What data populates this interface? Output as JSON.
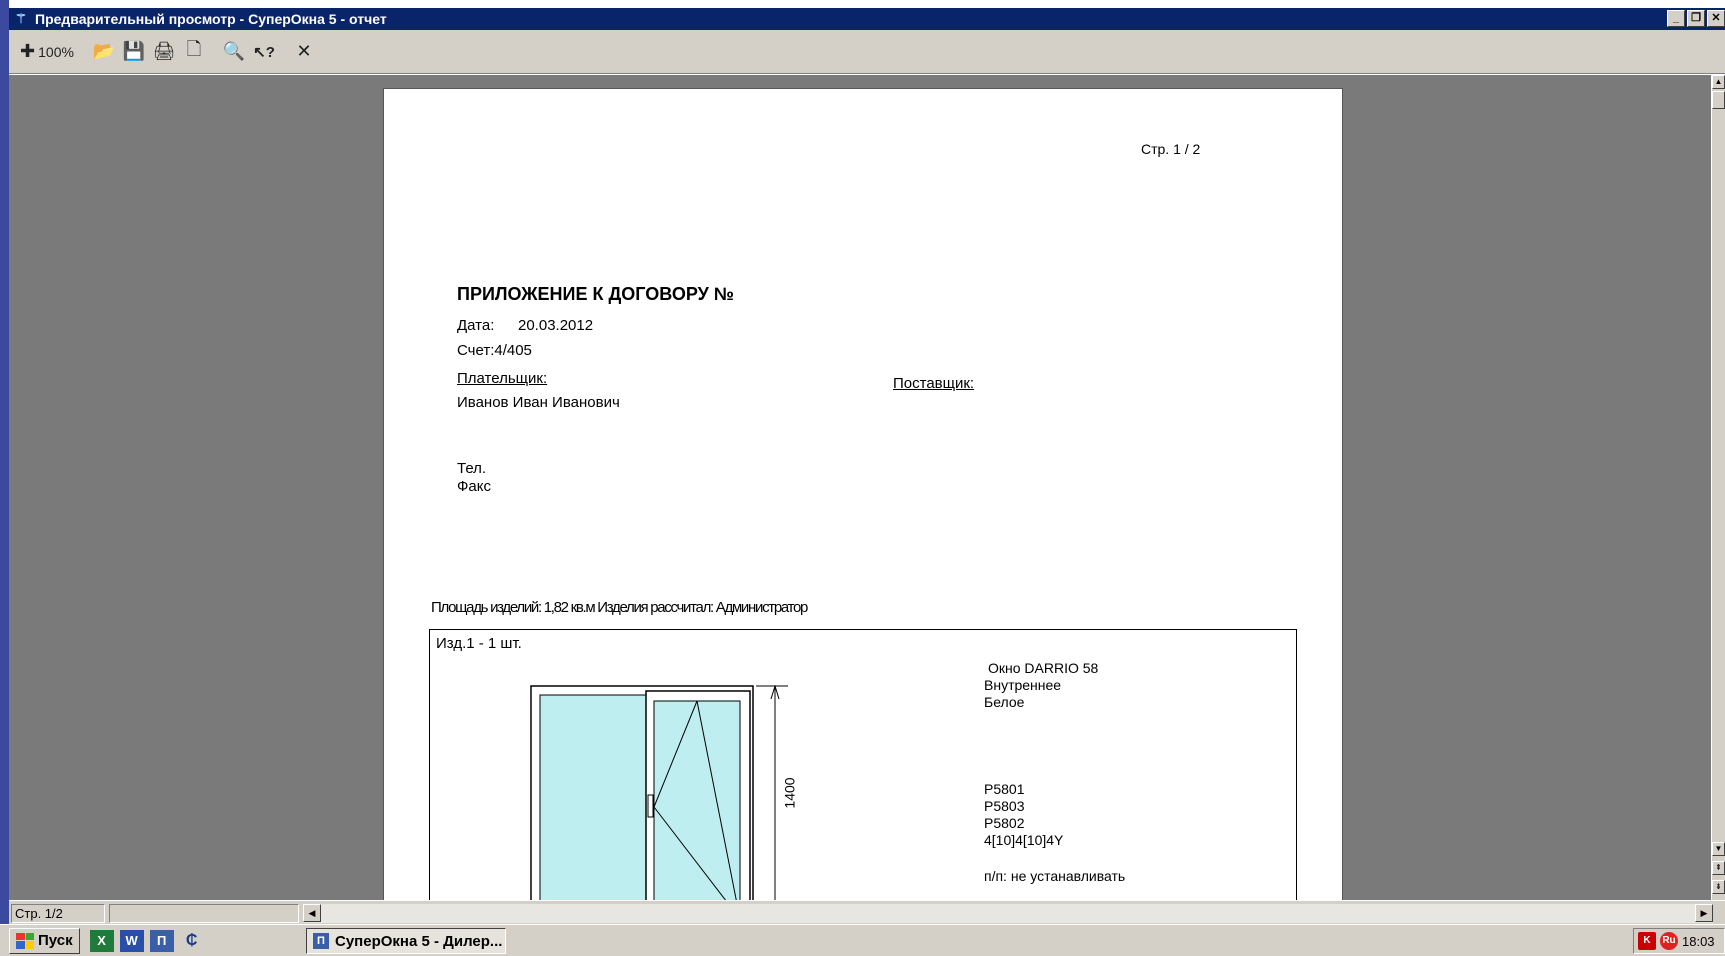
{
  "window": {
    "title": "Предварительный просмотр - СуперОкна 5 - отчет",
    "controls": [
      "minimize",
      "restore",
      "close"
    ]
  },
  "toolbar": {
    "zoom_label": "100%",
    "buttons": [
      "zoom",
      "open",
      "save",
      "print",
      "page-setup",
      "find",
      "help",
      "close"
    ]
  },
  "document": {
    "page_number": "Стр. 1 / 2",
    "title": "ПРИЛОЖЕНИЕ К ДОГОВОРУ №",
    "date_label": "Дата:",
    "date_value": "20.03.2012",
    "invoice": "Счет:4/405",
    "payer_label": "Плательщик:",
    "payer_name": "Иванов Иван Иванович",
    "supplier_label": "Поставщик:",
    "phone_label": "Тел.",
    "fax_label": "Факс",
    "area_line": "Площадь изделий: 1,82 кв.м  Изделия рассчитал: Администратор",
    "item": {
      "header": "Изд.1 - 1 шт.",
      "dimension": "1400",
      "props": [
        "Окно DARRIO 58",
        "Внутреннее",
        "Белое"
      ],
      "codes": [
        "P5801",
        "P5803",
        "P5802",
        "4[10]4[10]4Y"
      ],
      "note": "п/п: не устанавливать"
    }
  },
  "statusbar": {
    "page": "Стр. 1/2"
  },
  "taskbar": {
    "start_label": "Пуск",
    "task_label": "СуперОкна 5 - Дилер...",
    "clock": "18:03"
  },
  "colors": {
    "titlebar": "#0a246a",
    "viewport": "#7a7a7a",
    "glass": "#bfeef0"
  }
}
